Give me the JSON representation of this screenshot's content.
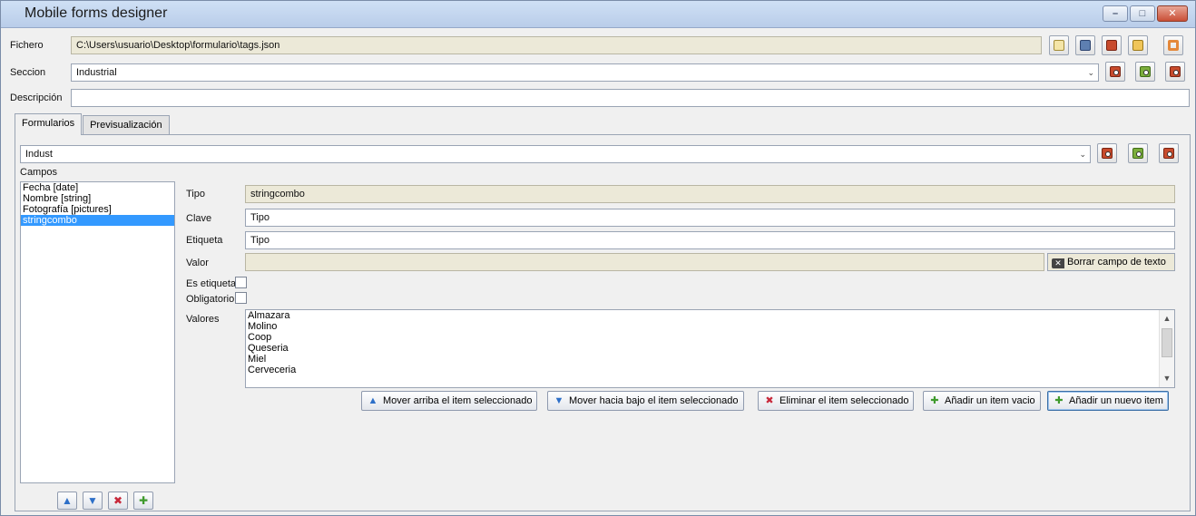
{
  "window": {
    "title": "Mobile forms designer",
    "controls": [
      "minimize-icon",
      "maximize-icon",
      "close-icon"
    ]
  },
  "file": {
    "label": "Fichero",
    "value": "C:\\Users\\usuario\\Desktop\\formulario\\tags.json",
    "icons": [
      "document-properties-icon",
      "save-icon",
      "edit-document-icon",
      "folder-icon",
      "lifebuoy-icon"
    ]
  },
  "section": {
    "label": "Seccion",
    "value": "Industrial",
    "icons": [
      "delete-section-icon",
      "add-section-icon",
      "edit-section-icon"
    ]
  },
  "description": {
    "label": "Descripción",
    "value": ""
  },
  "tabs": [
    {
      "label": "Formularios",
      "active": true
    },
    {
      "label": "Previsualización",
      "active": false
    }
  ],
  "form": {
    "value": "Indust",
    "icons": [
      "delete-form-icon",
      "add-form-icon",
      "edit-form-icon"
    ]
  },
  "fields": {
    "label": "Campos",
    "items": [
      "Fecha [date]",
      "Nombre [string]",
      "Fotografía [pictures]",
      "stringcombo"
    ],
    "selected_index": 3,
    "buttons": [
      "move-up-icon",
      "move-down-icon",
      "delete-icon",
      "add-icon"
    ]
  },
  "detail": {
    "tipo_label": "Tipo",
    "tipo_value": "stringcombo",
    "clave_label": "Clave",
    "clave_value": "Tipo",
    "etiqueta_label": "Etiqueta",
    "etiqueta_value": "Tipo",
    "valor_label": "Valor",
    "valor_value": "",
    "clear_button": "Borrar campo de texto",
    "es_etiqueta_label": "Es etiqueta",
    "es_etiqueta_checked": false,
    "obligatorio_label": "Obligatorio",
    "obligatorio_checked": false,
    "valores_label": "Valores",
    "valores": [
      "Almazara",
      "Molino",
      "Coop",
      "Queseria",
      "Miel",
      "Cerveceria"
    ]
  },
  "actions": {
    "move_up": "Mover arriba el item seleccionado",
    "move_down": "Mover hacia bajo el item seleccionado",
    "delete": "Eliminar el item seleccionado",
    "add_empty": "Añadir un item vacio",
    "add_new": "Añadir un nuevo item"
  }
}
